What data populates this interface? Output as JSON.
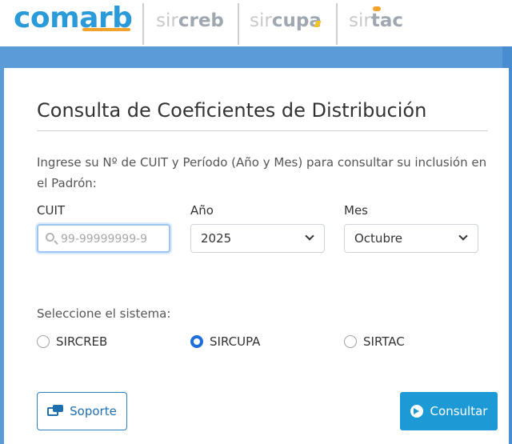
{
  "header": {
    "logo_comarb": {
      "part1": "com",
      "part2": "arb"
    },
    "logo_sircreb": {
      "part1": "sir",
      "part2": "creb"
    },
    "logo_sircupa": {
      "part1": "sir",
      "part2": "cupa"
    },
    "logo_sirtac": {
      "part1": "sir",
      "part2": "tac"
    }
  },
  "form": {
    "title": "Consulta de Coeficientes de Distribución",
    "description": "Ingrese su Nº de CUIT y Período (Año y Mes) para consultar su inclusión en el Padrón:",
    "cuit": {
      "label": "CUIT",
      "value": "",
      "placeholder": "99-99999999-9"
    },
    "anio": {
      "label": "Año",
      "selected": "2025"
    },
    "mes": {
      "label": "Mes",
      "selected": "Octubre"
    },
    "sistema": {
      "label": "Seleccione el sistema:",
      "options": [
        {
          "label": "SIRCREB",
          "selected": false
        },
        {
          "label": "SIRCUPA",
          "selected": true
        },
        {
          "label": "SIRTAC",
          "selected": false
        }
      ]
    },
    "buttons": {
      "soporte": "Soporte",
      "consultar": "Consultar"
    }
  },
  "colors": {
    "brand_blue": "#2a9bd8",
    "accent_orange": "#f2a32b",
    "band_blue": "#5b9bd8",
    "primary_button": "#1d9ad6",
    "radio_selected": "#1e6fd9"
  },
  "icons": {
    "cuit_field": "search-icon",
    "soporte_button": "support-icon",
    "consultar_button": "arrow-right-circle-icon",
    "select": "chevron-down-icon"
  }
}
